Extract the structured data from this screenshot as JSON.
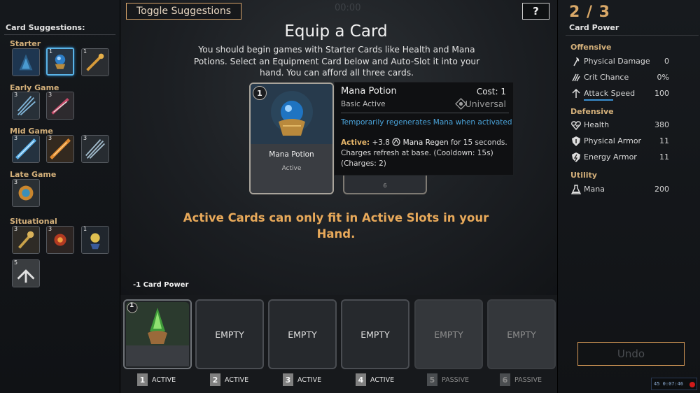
{
  "left": {
    "title": "Card Suggestions:",
    "categories": [
      {
        "name": "Starter",
        "cards": [
          {
            "cost": ""
          },
          {
            "cost": "1"
          },
          {
            "cost": "1"
          }
        ]
      },
      {
        "name": "Early Game",
        "cards": [
          {
            "cost": "3"
          },
          {
            "cost": "3"
          }
        ]
      },
      {
        "name": "Mid Game",
        "cards": [
          {
            "cost": "3"
          },
          {
            "cost": "3"
          },
          {
            "cost": "3"
          }
        ]
      },
      {
        "name": "Late Game",
        "cards": [
          {
            "cost": "3"
          }
        ]
      },
      {
        "name": "Situational",
        "cards": [
          {
            "cost": "3"
          },
          {
            "cost": "3"
          },
          {
            "cost": "1"
          },
          {
            "cost": "5"
          }
        ]
      }
    ]
  },
  "header": {
    "toggle_label": "Toggle Suggestions",
    "timer": "00:00",
    "help_label": "?"
  },
  "center": {
    "title": "Equip a Card",
    "description": "You should begin games with Starter Cards like Health and Mana Potions. Select an Equipment Card below and Auto-Slot it into your hand. You can afford all three cards.",
    "notice": "Active Cards can only fit in Active Slots in your Hand."
  },
  "card": {
    "cost": "1",
    "name": "Mana Potion",
    "type": "Active",
    "back_cost": "6"
  },
  "tooltip": {
    "name": "Mana Potion",
    "cost": "Cost: 1",
    "subtitle": "Basic Active",
    "universal": "Universal",
    "short_desc": "Temporarily regenerates Mana when activated",
    "active_label": "Active:",
    "active_value": "+3.8",
    "active_stat": "Mana Regen",
    "active_rest": "for 15 seconds. Charges refresh at base. (Cooldown: 15s) (Charges: 2)"
  },
  "hand": {
    "card_power_note": "-1 Card Power",
    "slots": [
      {
        "num": "1",
        "type": "ACTIVE",
        "content": "",
        "filled": true,
        "card_cost": "1"
      },
      {
        "num": "2",
        "type": "ACTIVE",
        "content": "EMPTY"
      },
      {
        "num": "3",
        "type": "ACTIVE",
        "content": "EMPTY"
      },
      {
        "num": "4",
        "type": "ACTIVE",
        "content": "EMPTY"
      },
      {
        "num": "5",
        "type": "PASSIVE",
        "content": "EMPTY"
      },
      {
        "num": "6",
        "type": "PASSIVE",
        "content": "EMPTY"
      }
    ]
  },
  "right": {
    "power_count": "2 / 3",
    "power_label": "Card Power",
    "sections": [
      {
        "name": "Offensive",
        "stats": [
          {
            "name": "Physical Damage",
            "value": "0",
            "icon": "axe-icon"
          },
          {
            "name": "Crit Chance",
            "value": "0%",
            "icon": "crit-icon"
          },
          {
            "name": "Attack Speed",
            "value": "100",
            "icon": "attack-speed-icon"
          }
        ]
      },
      {
        "name": "Defensive",
        "stats": [
          {
            "name": "Health",
            "value": "380",
            "icon": "heart-icon"
          },
          {
            "name": "Physical Armor",
            "value": "11",
            "icon": "physical-armor-icon"
          },
          {
            "name": "Energy Armor",
            "value": "11",
            "icon": "energy-armor-icon"
          }
        ]
      },
      {
        "name": "Utility",
        "stats": [
          {
            "name": "Mana",
            "value": "200",
            "icon": "mana-flask-icon"
          }
        ]
      }
    ],
    "undo_label": "Undo"
  },
  "hud": {
    "text": "45 0:07:46"
  },
  "colors": {
    "accent": "#d79a57",
    "gold_text": "#d4b07a",
    "link_blue": "#4aa3d9",
    "notice": "#e8a95a"
  }
}
